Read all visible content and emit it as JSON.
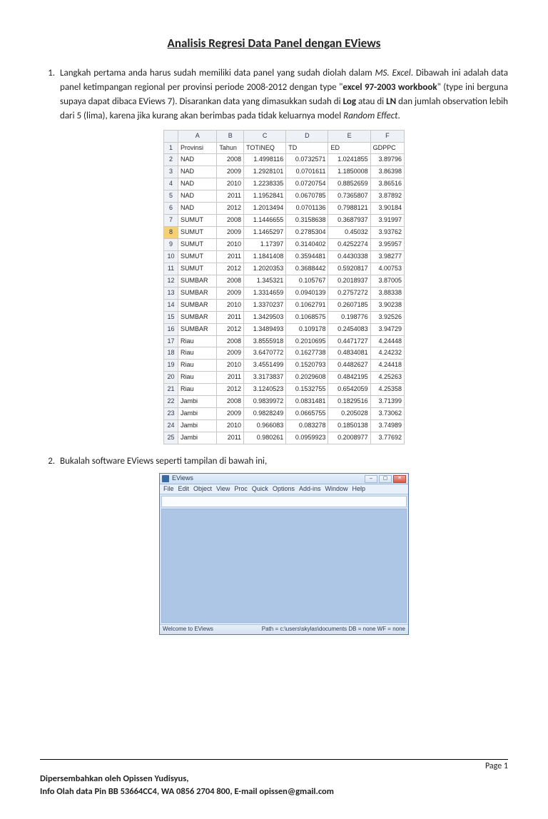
{
  "title": "Analisis Regresi Data Panel dengan EViews",
  "step1": {
    "part1": "Langkah pertama anda harus sudah memiliki data panel yang sudah diolah dalam ",
    "msexcel": "MS. Excel",
    "part2": ". Dibawah ini adalah data panel ketimpangan regional per provinsi periode 2008-2012 dengan type \"",
    "wbtype": "excel 97-2003 workbook",
    "part3": "\" (type ini berguna supaya dapat dibaca EViews 7). Disarankan data yang dimasukkan sudah di ",
    "log": "Log",
    "part4": " atau di ",
    "ln": "LN",
    "part5": " dan jumlah observation lebih dari 5 (lima), karena jika kurang akan berimbas pada tidak keluarnya model ",
    "rand": "Random Effect",
    "part6": "."
  },
  "step2": "Bukalah software EViews seperti tampilan di bawah ini,",
  "sheet": {
    "cols": [
      "",
      "A",
      "B",
      "C",
      "D",
      "E",
      "F"
    ],
    "headers": [
      "Provinsi",
      "Tahun",
      "TOTINEQ",
      "TD",
      "ED",
      "GDPPC"
    ],
    "rows": [
      [
        "NAD",
        "2008",
        "1.4998116",
        "0.0732571",
        "1.0241855",
        "3.89796"
      ],
      [
        "NAD",
        "2009",
        "1.2928101",
        "0.0701611",
        "1.1850008",
        "3.86398"
      ],
      [
        "NAD",
        "2010",
        "1.2238335",
        "0.0720754",
        "0.8852659",
        "3.86516"
      ],
      [
        "NAD",
        "2011",
        "1.1952841",
        "0.0670785",
        "0.7365807",
        "3.87892"
      ],
      [
        "NAD",
        "2012",
        "1.2013494",
        "0.0701136",
        "0.7988121",
        "3.90184"
      ],
      [
        "SUMUT",
        "2008",
        "1.1446655",
        "0.3158638",
        "0.3687937",
        "3.91997"
      ],
      [
        "SUMUT",
        "2009",
        "1.1465297",
        "0.2785304",
        "0.45032",
        "3.93762"
      ],
      [
        "SUMUT",
        "2010",
        "1.17397",
        "0.3140402",
        "0.4252274",
        "3.95957"
      ],
      [
        "SUMUT",
        "2011",
        "1.1841408",
        "0.3594481",
        "0.4430338",
        "3.98277"
      ],
      [
        "SUMUT",
        "2012",
        "1.2020353",
        "0.3688442",
        "0.5920817",
        "4.00753"
      ],
      [
        "SUMBAR",
        "2008",
        "1.345321",
        "0.105767",
        "0.2018937",
        "3.87005"
      ],
      [
        "SUMBAR",
        "2009",
        "1.3314659",
        "0.0940139",
        "0.2757272",
        "3.88338"
      ],
      [
        "SUMBAR",
        "2010",
        "1.3370237",
        "0.1062791",
        "0.2607185",
        "3.90238"
      ],
      [
        "SUMBAR",
        "2011",
        "1.3429503",
        "0.1068575",
        "0.198776",
        "3.92526"
      ],
      [
        "SUMBAR",
        "2012",
        "1.3489493",
        "0.109178",
        "0.2454083",
        "3.94729"
      ],
      [
        "Riau",
        "2008",
        "3.8555918",
        "0.2010695",
        "0.4471727",
        "4.24448"
      ],
      [
        "Riau",
        "2009",
        "3.6470772",
        "0.1627738",
        "0.4834081",
        "4.24232"
      ],
      [
        "Riau",
        "2010",
        "3.4551499",
        "0.1520793",
        "0.4482627",
        "4.24418"
      ],
      [
        "Riau",
        "2011",
        "3.3173837",
        "0.2029608",
        "0.4842195",
        "4.25263"
      ],
      [
        "Riau",
        "2012",
        "3.1240523",
        "0.1532755",
        "0.6542059",
        "4.25358"
      ],
      [
        "Jambi",
        "2008",
        "0.9839972",
        "0.0831481",
        "0.1829516",
        "3.71399"
      ],
      [
        "Jambi",
        "2009",
        "0.9828249",
        "0.0665755",
        "0.205028",
        "3.73062"
      ],
      [
        "Jambi",
        "2010",
        "0.966083",
        "0.083278",
        "0.1850138",
        "3.74989"
      ],
      [
        "Jambi",
        "2011",
        "0.980261",
        "0.0959923",
        "0.2008977",
        "3.77692"
      ]
    ],
    "selrow": 8
  },
  "eviews": {
    "title": "EViews",
    "menu": [
      "File",
      "Edit",
      "Object",
      "View",
      "Proc",
      "Quick",
      "Options",
      "Add-ins",
      "Window",
      "Help"
    ],
    "status_left": "Welcome to EViews",
    "status_right": "Path = c:\\users\\skylas\\documents    DB = none    WF = none"
  },
  "footer": {
    "pagelabel": "Page 1",
    "line1": "Dipersembahkan oleh Opissen Yudisyus,",
    "line2": "Info Olah data Pin BB 53664CC4, WA 0856 2704 800, E-mail opissen@gmail.com"
  }
}
